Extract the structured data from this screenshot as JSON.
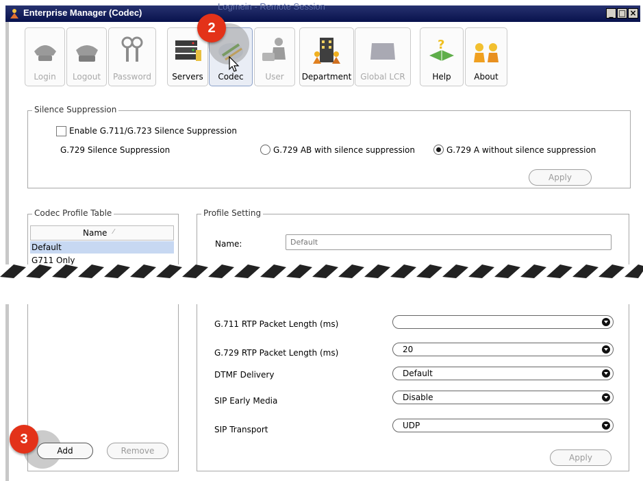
{
  "window": {
    "title": "Enterprise Manager  (Codec)",
    "ghost_title": "Logmein - Remote Session",
    "controls": [
      "minimize-icon",
      "maximize-icon",
      "close-icon"
    ]
  },
  "toolbar": [
    {
      "label": "Login",
      "icon": "login-telephone-icon",
      "enabled": false
    },
    {
      "label": "Logout",
      "icon": "logout-telephone-icon",
      "enabled": false
    },
    {
      "label": "Password",
      "icon": "keys-icon",
      "enabled": false
    },
    {
      "label": "Servers",
      "icon": "servers-icon",
      "enabled": true
    },
    {
      "label": "Codec",
      "icon": "codec-icon",
      "enabled": true,
      "active": true
    },
    {
      "label": "User",
      "icon": "user-phone-icon",
      "enabled": false
    },
    {
      "label": "Department",
      "icon": "department-building-icon",
      "enabled": true
    },
    {
      "label": "Global LCR",
      "icon": "global-lcr-icon",
      "enabled": false
    },
    {
      "label": "Help",
      "icon": "help-book-icon",
      "enabled": true
    },
    {
      "label": "About",
      "icon": "about-people-icon",
      "enabled": true
    }
  ],
  "callouts": {
    "codec_step": "2",
    "add_step": "3"
  },
  "silence": {
    "title": "Silence Suppression",
    "enable_label": "Enable G.711/G.723 Silence Suppression",
    "g729_label": "G.729 Silence Suppression",
    "option_ab": "G.729 AB with silence suppression",
    "option_a": "G.729 A without silence suppression",
    "selected": "option_a",
    "apply": "Apply"
  },
  "profile_table": {
    "title": "Codec Profile Table",
    "column": "Name",
    "sort_icon": "sort-indicator-icon",
    "rows": [
      "Default",
      "G711 Only"
    ],
    "selected": "Default",
    "add": "Add",
    "remove": "Remove"
  },
  "profile_setting": {
    "title": "Profile Setting",
    "name_label": "Name:",
    "name_placeholder": "Default",
    "g711_label": "G.711 RTP Packet Length (ms)",
    "g729_label": "G.729 RTP Packet Length (ms)",
    "g729_value": "20",
    "dtmf_label": "DTMF Delivery",
    "dtmf_value": "Default",
    "early_media_label": "SIP Early Media",
    "early_media_value": "Disable",
    "transport_label": "SIP Transport",
    "transport_value": "UDP",
    "apply": "Apply"
  }
}
